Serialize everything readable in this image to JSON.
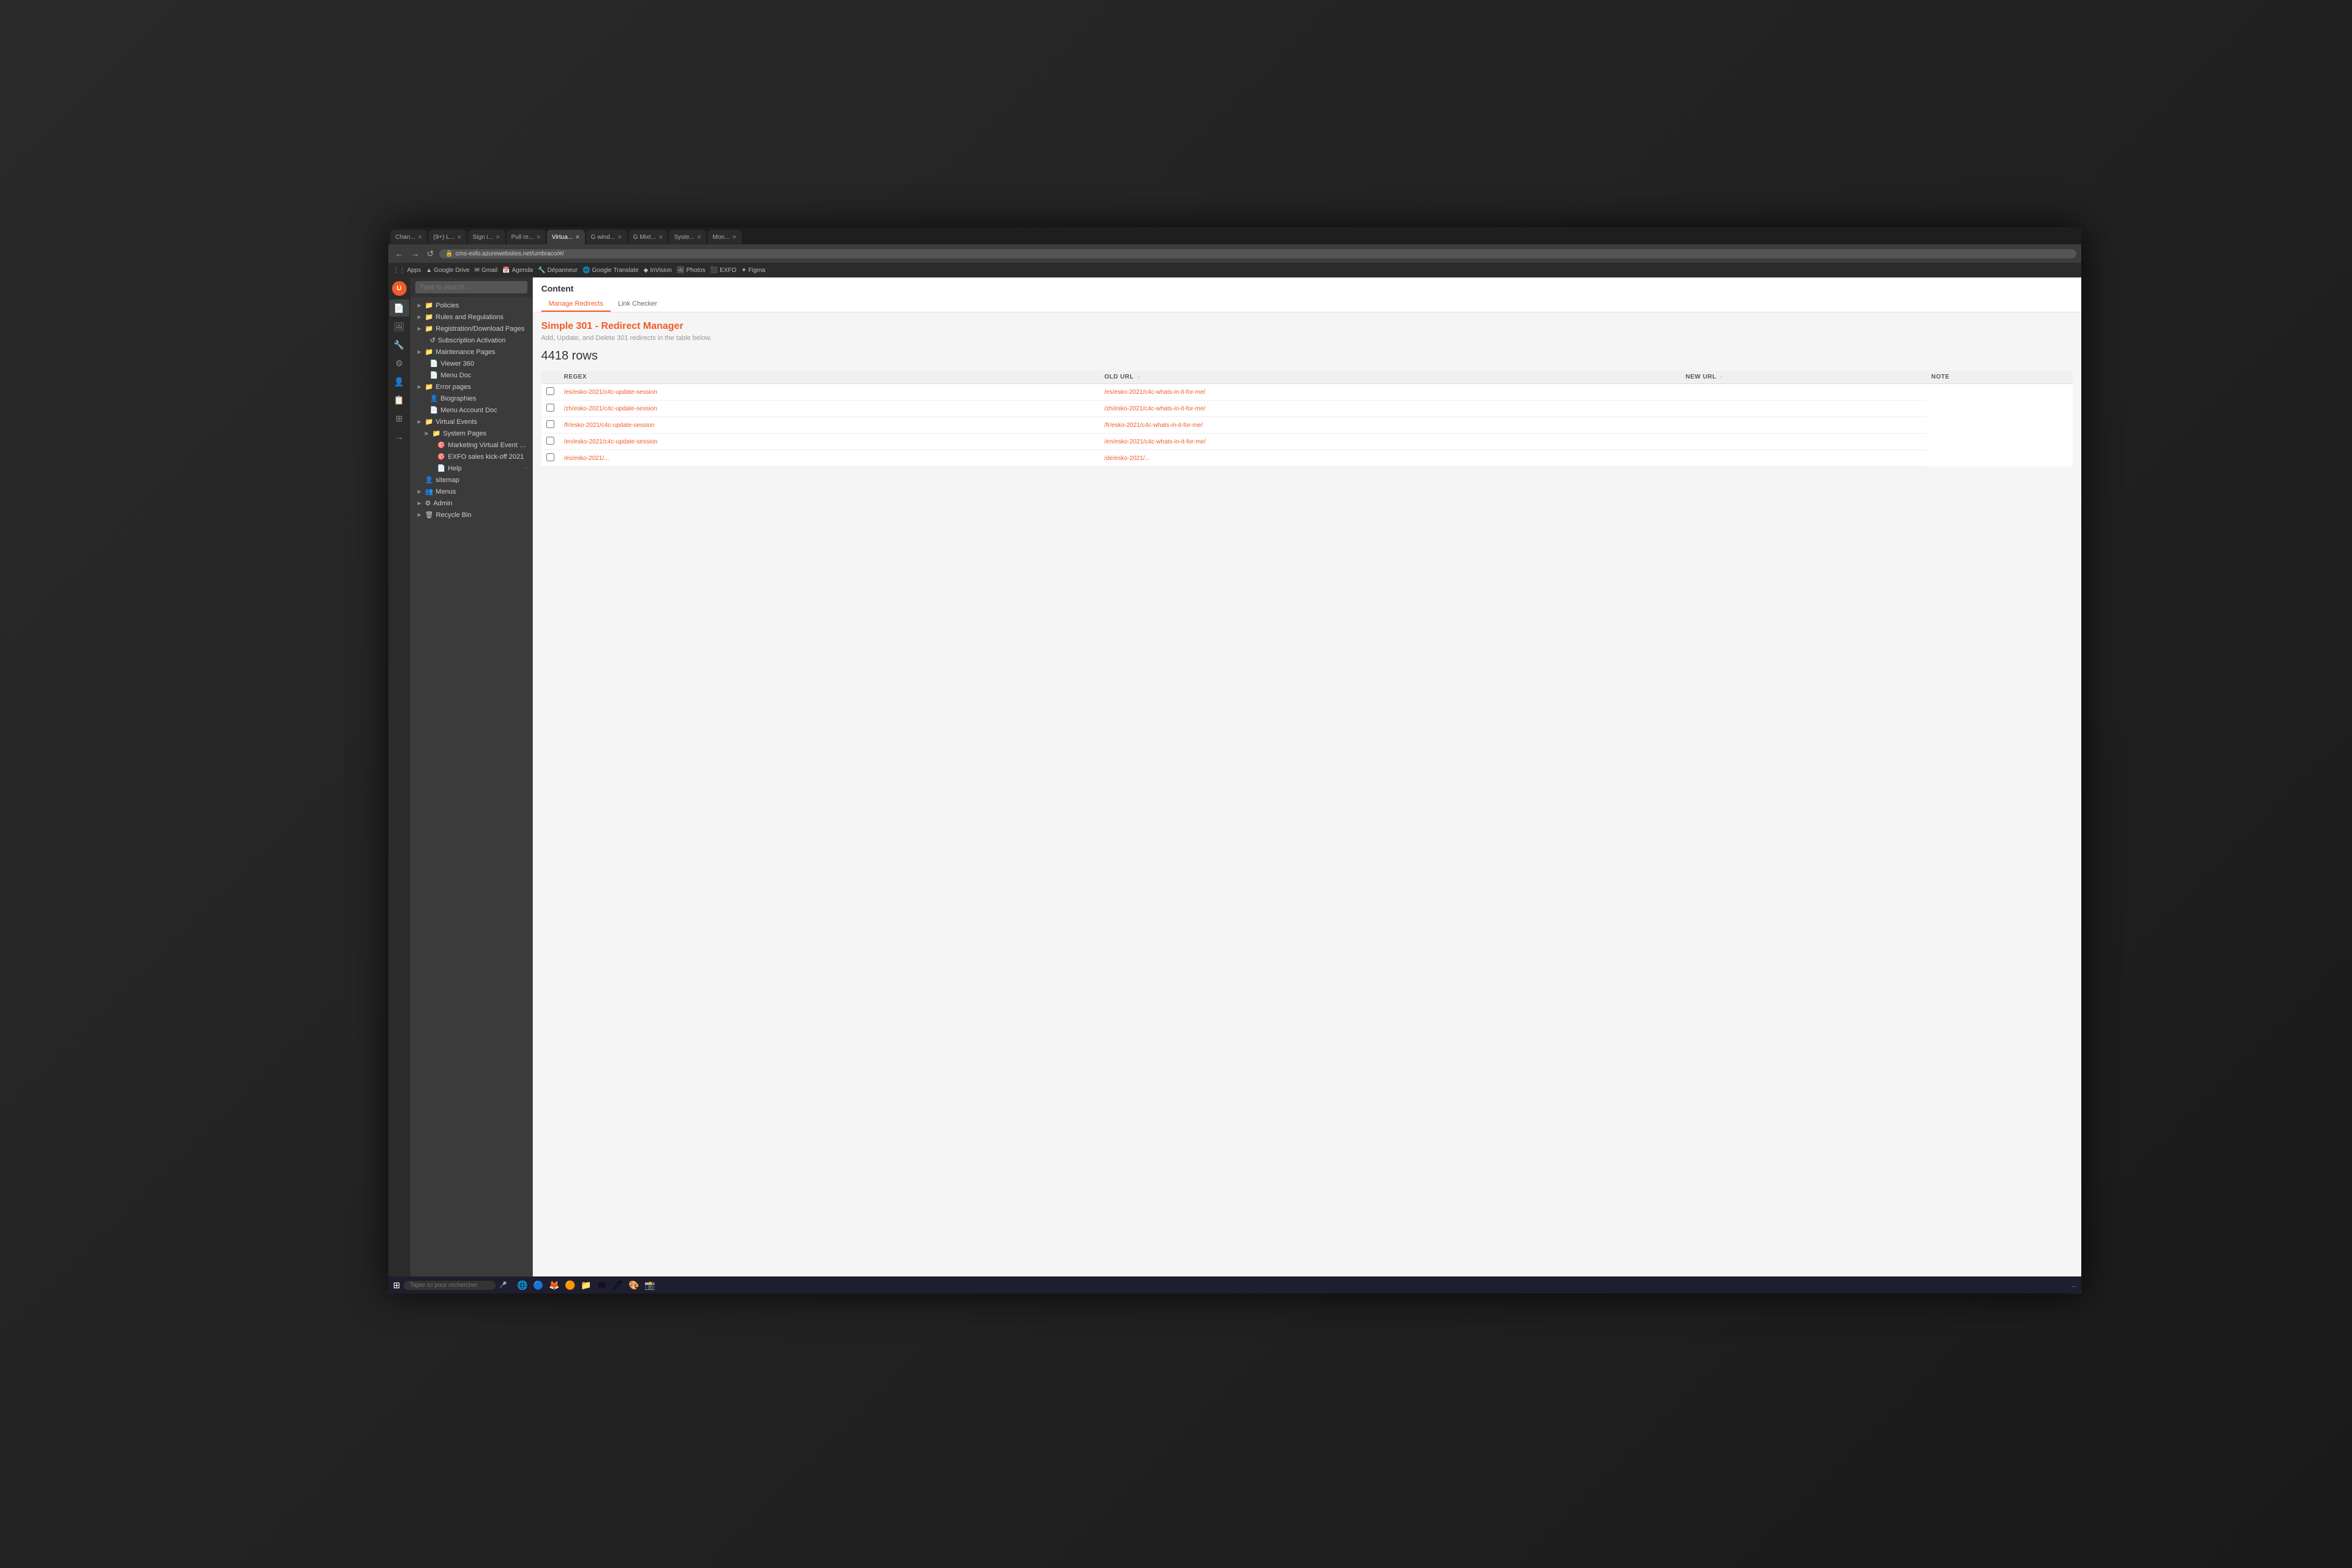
{
  "browser": {
    "tabs": [
      {
        "label": "Chan...",
        "active": false
      },
      {
        "label": "(9+) L...",
        "active": false
      },
      {
        "label": "Sign i...",
        "active": false
      },
      {
        "label": "Pull re...",
        "active": false
      },
      {
        "label": "Virtua...",
        "active": true
      },
      {
        "label": "G wind...",
        "active": false
      },
      {
        "label": "G Mixt...",
        "active": false
      },
      {
        "label": "Syste...",
        "active": false
      },
      {
        "label": "Mon...",
        "active": false
      }
    ],
    "address": "cms-exfo.azurewebsites.net/umbraco/#/",
    "bookmarks": [
      "Apps",
      "Google Drive",
      "Gmail",
      "Agenda",
      "Dépanneur",
      "Google Translate",
      "InVision",
      "Photos",
      "EXFO",
      "Figma"
    ]
  },
  "sidebar": {
    "logo": "U",
    "icons": [
      {
        "name": "document-icon",
        "symbol": "📄"
      },
      {
        "name": "image-icon",
        "symbol": "🖼"
      },
      {
        "name": "wrench-icon",
        "symbol": "🔧"
      },
      {
        "name": "gear-icon",
        "symbol": "⚙"
      },
      {
        "name": "user-icon",
        "symbol": "👤"
      },
      {
        "name": "list-icon",
        "symbol": "📋"
      },
      {
        "name": "grid-icon",
        "symbol": "⊞"
      },
      {
        "name": "arrow-icon",
        "symbol": "→"
      },
      {
        "name": "help-icon",
        "symbol": "?"
      }
    ]
  },
  "search": {
    "placeholder": "Type to search..."
  },
  "tree": {
    "items": [
      {
        "level": 1,
        "arrow": "▶",
        "icon": "📁",
        "label": "Policies",
        "indent": 12
      },
      {
        "level": 1,
        "arrow": "▶",
        "icon": "📁",
        "label": "Rules and Regulations",
        "indent": 12
      },
      {
        "level": 1,
        "arrow": "▶",
        "icon": "📁",
        "label": "Registration/Download Pages",
        "indent": 12
      },
      {
        "level": 0,
        "arrow": "",
        "icon": "↺",
        "label": "Subscription Activation",
        "indent": 20
      },
      {
        "level": 1,
        "arrow": "▶",
        "icon": "📁",
        "label": "Maintenance Pages",
        "indent": 12
      },
      {
        "level": 0,
        "arrow": "",
        "icon": "📄",
        "label": "Viewer 360",
        "indent": 20
      },
      {
        "level": 0,
        "arrow": "",
        "icon": "📄",
        "label": "Menu Doc",
        "indent": 20
      },
      {
        "level": 1,
        "arrow": "▶",
        "icon": "📁",
        "label": "Error pages",
        "indent": 12
      },
      {
        "level": 0,
        "arrow": "",
        "icon": "👤",
        "label": "Biographies",
        "indent": 20
      },
      {
        "level": 0,
        "arrow": "",
        "icon": "📄",
        "label": "Menu Account Doc",
        "indent": 20
      },
      {
        "level": 1,
        "arrow": "▶",
        "icon": "📁",
        "label": "Virtual Events",
        "indent": 12
      },
      {
        "level": 2,
        "arrow": "▶",
        "icon": "📁",
        "label": "System Pages",
        "indent": 24
      },
      {
        "level": 0,
        "arrow": "",
        "icon": "🎯",
        "label": "Marketing Virtual Event Demo",
        "indent": 32
      },
      {
        "level": 0,
        "arrow": "",
        "icon": "🎯",
        "label": "EXFO sales kick-off 2021",
        "indent": 32
      },
      {
        "level": 0,
        "arrow": "",
        "icon": "📄",
        "label": "Help",
        "indent": 32,
        "dots": "···"
      },
      {
        "level": 0,
        "arrow": "",
        "icon": "👤",
        "label": "sitemap",
        "indent": 12
      },
      {
        "level": 1,
        "arrow": "▶",
        "icon": "👥",
        "label": "Menus",
        "indent": 12
      },
      {
        "level": 1,
        "arrow": "▶",
        "icon": "⚙",
        "label": "Admin",
        "indent": 12
      },
      {
        "level": 1,
        "arrow": "▶",
        "icon": "🗑",
        "label": "Recycle Bin",
        "indent": 12
      }
    ]
  },
  "content": {
    "title": "Content",
    "tabs": [
      {
        "label": "Manage Redirects",
        "active": true
      },
      {
        "label": "Link Checker",
        "active": false
      }
    ],
    "redirect_manager": {
      "title": "Simple 301 - Redirect Manager",
      "subtitle": "Add, Update, and Delete 301 redirects in the table below.",
      "row_count": "4418 rows",
      "table": {
        "columns": [
          {
            "label": "REGEX"
          },
          {
            "label": "OLD URL"
          },
          {
            "label": "NEW URL"
          },
          {
            "label": "NOTE"
          }
        ],
        "rows": [
          {
            "old_url": "/es/esko-2021/c4c-update-session",
            "new_url": "/es/esko-2021/c4c-whats-in-it-for-me/",
            "note": ""
          },
          {
            "old_url": "/zh/esko-2021/c4c-update-session",
            "new_url": "/zh/esko-2021/c4c-whats-in-it-for-me/",
            "note": ""
          },
          {
            "old_url": "/fr/esko-2021/c4c-update-session",
            "new_url": "/fr/esko-2021/c4c-whats-in-it-for-me/",
            "note": ""
          },
          {
            "old_url": "/en/esko-2021/c4c-update-session",
            "new_url": "/en/esko-2021/c4c-whats-in-it-for-me/",
            "note": ""
          },
          {
            "old_url": "/es/esko-2021/...",
            "new_url": "/de/esko-2021/...",
            "note": ""
          }
        ]
      }
    }
  },
  "taskbar": {
    "search_placeholder": "Taper ici pour rechercher",
    "apps": [
      "⊞",
      "🌐",
      "📁",
      "🔥",
      "🔵",
      "🎵",
      "💼",
      "🖊",
      "🗂"
    ],
    "time": "..."
  }
}
